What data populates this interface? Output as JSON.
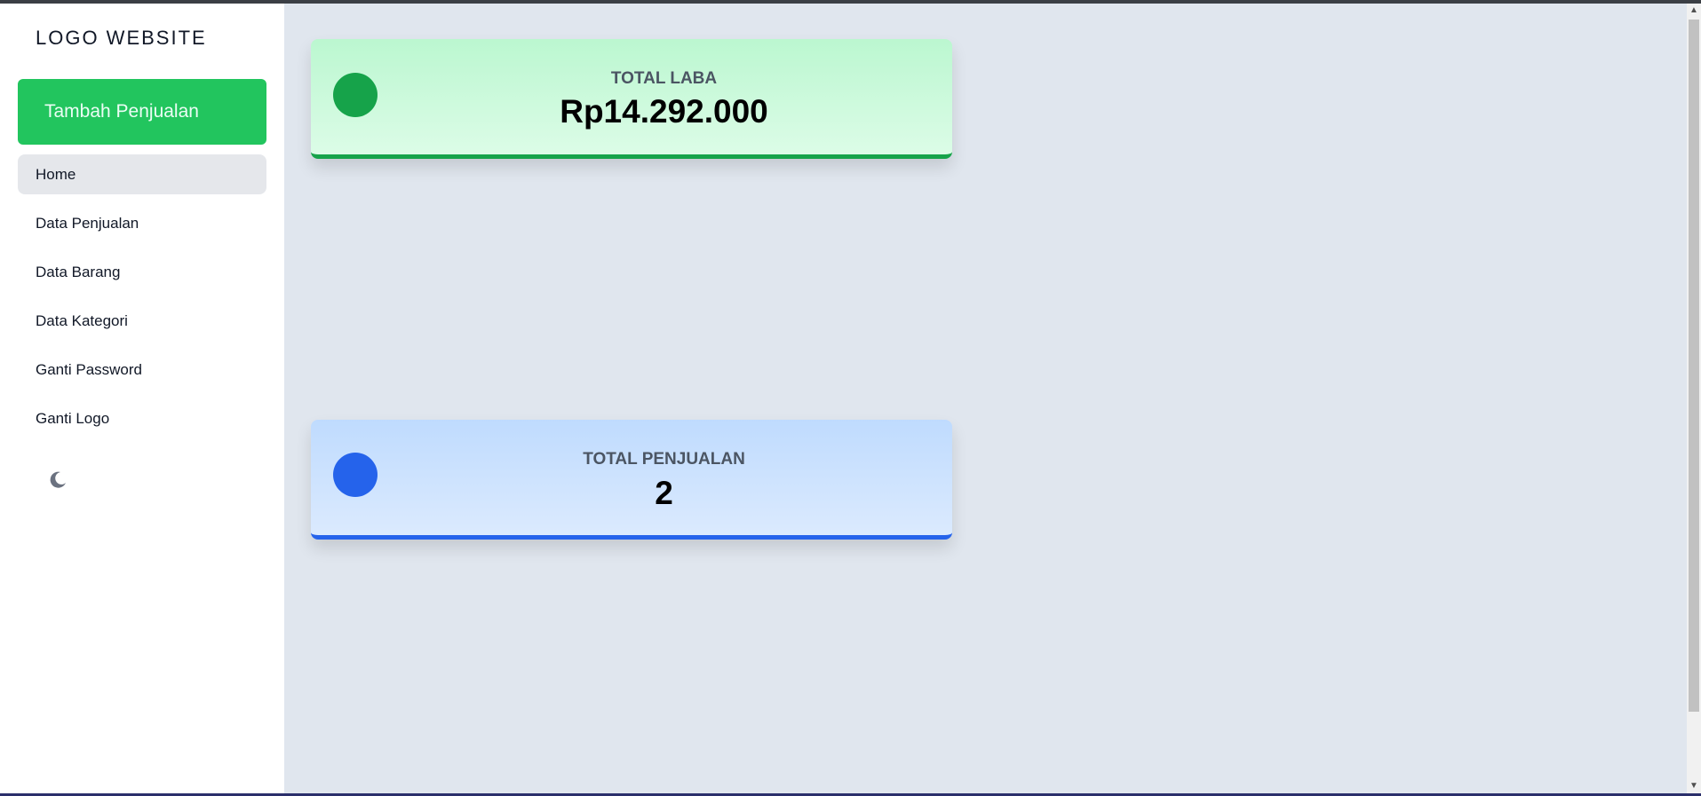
{
  "sidebar": {
    "logo": "LOGO WEBSITE",
    "add_button": "Tambah Penjualan",
    "items": [
      {
        "label": "Home",
        "active": true
      },
      {
        "label": "Data Penjualan"
      },
      {
        "label": "Data Barang"
      },
      {
        "label": "Data Kategori"
      },
      {
        "label": "Ganti Password"
      },
      {
        "label": "Ganti Logo"
      }
    ],
    "theme_icon": "moon-icon"
  },
  "cards": [
    {
      "label": "TOTAL LABA",
      "value": "Rp14.292.000",
      "color": "#16a34a"
    },
    {
      "label": "TOTAL PENJUALAN",
      "value": "2",
      "color": "#2563eb"
    }
  ],
  "scrollbar": {
    "up_icon": "▲",
    "down_icon": "▼"
  },
  "colors": {
    "accent_green": "#22c55e",
    "accent_blue": "#2563eb",
    "background": "#e0e6ee"
  }
}
